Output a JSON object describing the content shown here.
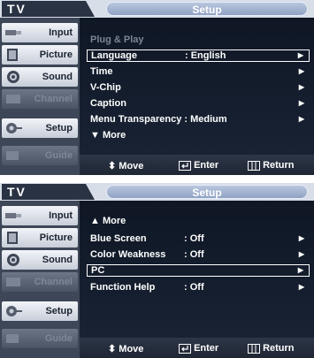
{
  "panels": [
    {
      "header": {
        "tv_label": "TV",
        "title": "Setup"
      },
      "sidebar": [
        {
          "label": "Input",
          "icon": "input-icon",
          "dim": false
        },
        {
          "label": "Picture",
          "icon": "picture-icon",
          "dim": false
        },
        {
          "label": "Sound",
          "icon": "sound-icon",
          "dim": false
        },
        {
          "label": "Channel",
          "icon": "channel-icon",
          "dim": true
        },
        {
          "label": "Setup",
          "icon": "setup-icon",
          "dim": false
        },
        {
          "label": "Guide",
          "icon": "guide-icon",
          "dim": true
        }
      ],
      "rows": [
        {
          "label": "Plug & Play",
          "value": "",
          "arrow": false,
          "disabled": true,
          "selected": false
        },
        {
          "label": "Language",
          "value": ": English",
          "arrow": true,
          "disabled": false,
          "selected": true
        },
        {
          "label": "Time",
          "value": "",
          "arrow": true,
          "disabled": false,
          "selected": false
        },
        {
          "label": "V-Chip",
          "value": "",
          "arrow": true,
          "disabled": false,
          "selected": false
        },
        {
          "label": "Caption",
          "value": "",
          "arrow": true,
          "disabled": false,
          "selected": false
        },
        {
          "label": "Menu Transparency : Medium",
          "value": "",
          "arrow": true,
          "disabled": false,
          "selected": false
        },
        {
          "label": "▼ More",
          "value": "",
          "arrow": false,
          "disabled": false,
          "selected": false
        }
      ],
      "footer": {
        "move": "Move",
        "enter": "Enter",
        "return": "Return"
      }
    },
    {
      "header": {
        "tv_label": "TV",
        "title": "Setup"
      },
      "sidebar": [
        {
          "label": "Input",
          "icon": "input-icon",
          "dim": false
        },
        {
          "label": "Picture",
          "icon": "picture-icon",
          "dim": false
        },
        {
          "label": "Sound",
          "icon": "sound-icon",
          "dim": false
        },
        {
          "label": "Channel",
          "icon": "channel-icon",
          "dim": true
        },
        {
          "label": "Setup",
          "icon": "setup-icon",
          "dim": false
        },
        {
          "label": "Guide",
          "icon": "guide-icon",
          "dim": true
        }
      ],
      "rows": [
        {
          "label": "▲ More",
          "value": "",
          "arrow": false,
          "disabled": false,
          "selected": false
        },
        {
          "label": "Blue Screen",
          "value": ": Off",
          "arrow": true,
          "disabled": false,
          "selected": false
        },
        {
          "label": "Color Weakness",
          "value": ": Off",
          "arrow": true,
          "disabled": false,
          "selected": false
        },
        {
          "label": "PC",
          "value": "",
          "arrow": true,
          "disabled": false,
          "selected": true
        },
        {
          "label": "Function Help",
          "value": ": Off",
          "arrow": true,
          "disabled": false,
          "selected": false
        }
      ],
      "footer": {
        "move": "Move",
        "enter": "Enter",
        "return": "Return"
      }
    }
  ]
}
